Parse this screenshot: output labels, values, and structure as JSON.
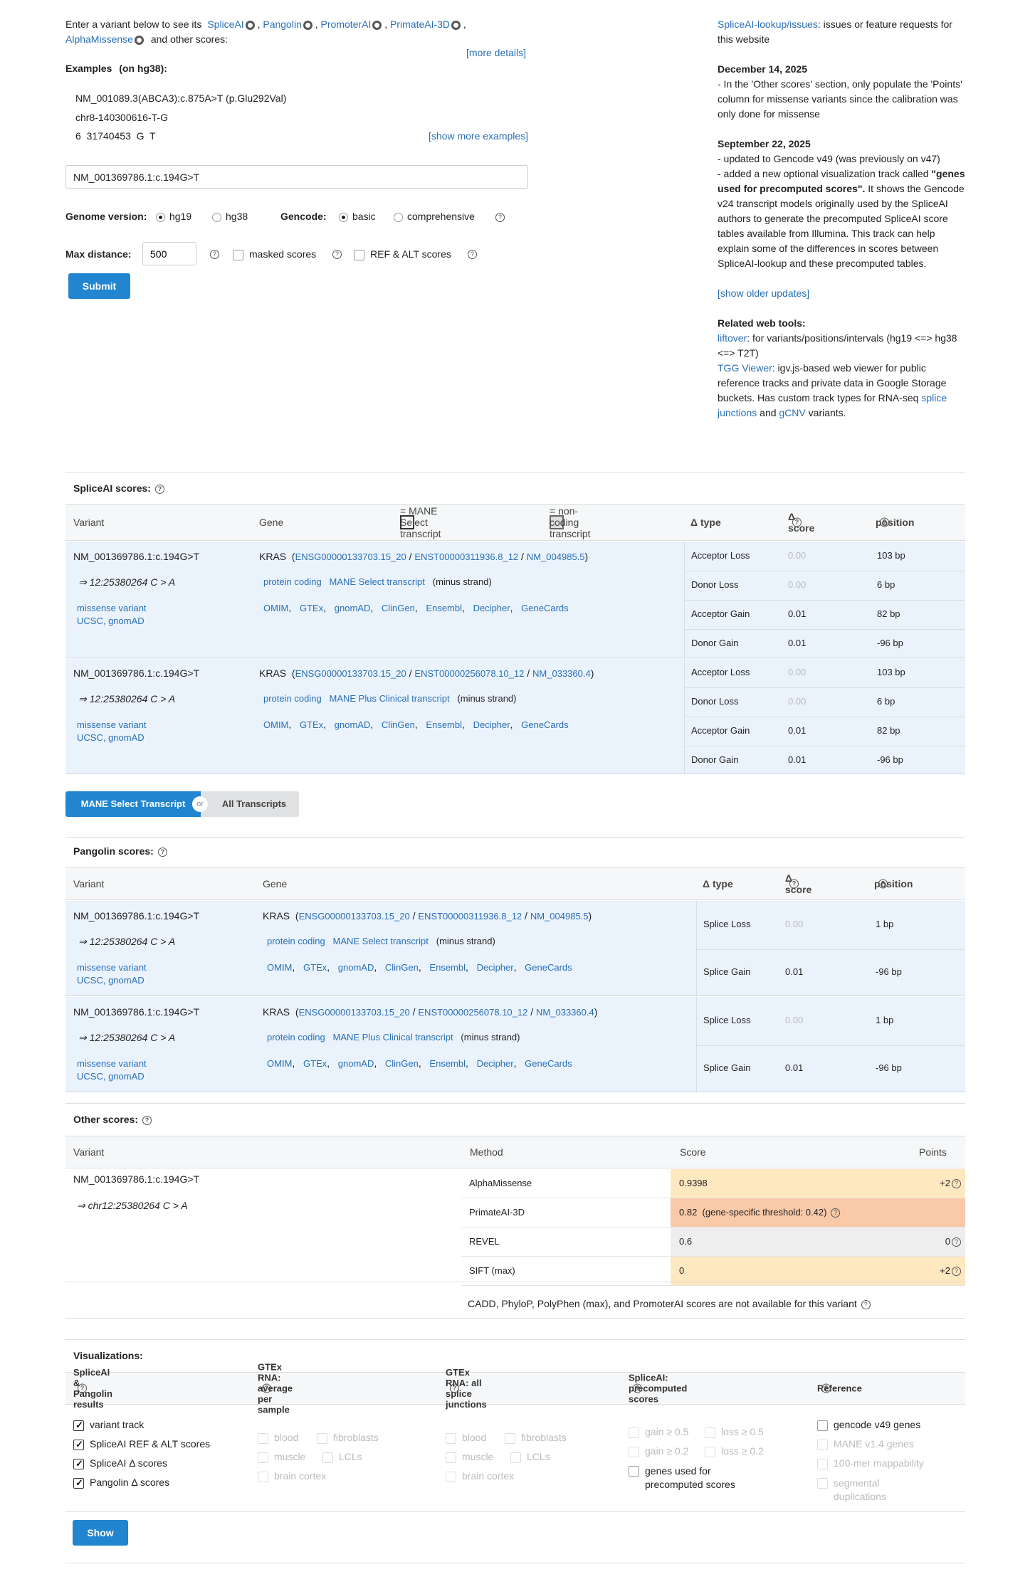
{
  "intro": {
    "text_before": "Enter a variant below to see its",
    "tools": [
      "SpliceAI",
      "Pangolin",
      "PromoterAI",
      "PrimateAI-3D",
      "AlphaMissense"
    ],
    "text_after": "and other scores:",
    "more_details": "[more details]"
  },
  "examples": {
    "title": "Examples",
    "subtitle": "(on hg38):",
    "items": [
      "NM_001089.3(ABCA3):c.875A>T (p.Glu292Val)",
      "chr8-140300616-T-G",
      "6  31740453  G  T"
    ],
    "show_more": "[show more examples]"
  },
  "variant_input": {
    "value": "NM_001369786.1:c.194G>T"
  },
  "options": {
    "genome_label": "Genome version:",
    "genome_options": [
      "hg19",
      "hg38"
    ],
    "gencode_label": "Gencode:",
    "gencode_options": [
      "basic",
      "comprehensive"
    ],
    "max_distance_label": "Max distance:",
    "max_distance_value": "500",
    "masked_label": "masked scores",
    "refalt_label": "REF & ALT scores",
    "submit": "Submit"
  },
  "sidebar": {
    "issues_link": "SpliceAI-lookup/issues",
    "issues_text": ": issues or feature requests for this website",
    "update1_date": "December 14, 2025",
    "update1_text": "- In the 'Other scores' section, only populate the 'Points' column for missense variants since the calibration was only done for missense",
    "update2_date": "September 22, 2025",
    "update2_line1": "- updated to Gencode v49 (was previously on v47)",
    "update2_line2a": "- added a new optional visualization track called",
    "update2_bold": "\"genes used for precomputed scores\".",
    "update2_line2b": "It shows the Gencode v24 transcript models originally used by the SpliceAI authors to generate the precomputed SpliceAI score tables available from Illumina. This track can help explain some of the differences in scores between SpliceAI-lookup and these precomputed tables.",
    "show_older": "[show older updates]",
    "related_title": "Related web tools:",
    "liftover_link": "liftover",
    "liftover_text": ": for variants/positions/intervals (hg19 <=> hg38 <=> T2T)",
    "tgg_link": "TGG Viewer",
    "tgg_text": ": igv.js-based web viewer for public reference tracks and private data in Google Storage buckets. Has custom track types for RNA-seq",
    "splice_link": "splice junctions",
    "and_text": "and",
    "gcnv_link": "gCNV",
    "variants_text": "variants."
  },
  "spliceai": {
    "title": "SpliceAI scores:",
    "headers": {
      "variant": "Variant",
      "gene": "Gene",
      "mane_legend": "= MANE Select transcript",
      "noncoding_legend": "= non-coding transcript",
      "type": "Δ type",
      "score": "Δ score",
      "position": "position"
    },
    "groups": [
      {
        "variant": "NM_001369786.1:c.194G>T",
        "coord": "⇒ 12:25380264 C > A",
        "consequence": "missense variant",
        "link_ucsc": "UCSC",
        "link_gnomad": "gnomAD",
        "gene": "KRAS",
        "ensg": "ENSG00000133703.15_20",
        "enst": "ENST00000311936.8_12",
        "nm": "NM_004985.5",
        "biotype": "protein coding",
        "tag": "MANE Select transcript",
        "strand": "(minus strand)",
        "links": [
          "OMIM",
          "GTEx",
          "gnomAD",
          "ClinGen",
          "Ensembl",
          "Decipher",
          "GeneCards"
        ],
        "rows": [
          {
            "type": "Acceptor Loss",
            "score": "0.00",
            "pos": "103 bp"
          },
          {
            "type": "Donor Loss",
            "score": "0.00",
            "pos": "6 bp"
          },
          {
            "type": "Acceptor Gain",
            "score": "0.01",
            "pos": "82 bp"
          },
          {
            "type": "Donor Gain",
            "score": "0.01",
            "pos": "-96 bp"
          }
        ]
      },
      {
        "variant": "NM_001369786.1:c.194G>T",
        "coord": "⇒ 12:25380264 C > A",
        "consequence": "missense variant",
        "link_ucsc": "UCSC",
        "link_gnomad": "gnomAD",
        "gene": "KRAS",
        "ensg": "ENSG00000133703.15_20",
        "enst": "ENST00000256078.10_12",
        "nm": "NM_033360.4",
        "biotype": "protein coding",
        "tag": "MANE Plus Clinical transcript",
        "strand": "(minus strand)",
        "links": [
          "OMIM",
          "GTEx",
          "gnomAD",
          "ClinGen",
          "Ensembl",
          "Decipher",
          "GeneCards"
        ],
        "rows": [
          {
            "type": "Acceptor Loss",
            "score": "0.00",
            "pos": "103 bp"
          },
          {
            "type": "Donor Loss",
            "score": "0.00",
            "pos": "6 bp"
          },
          {
            "type": "Acceptor Gain",
            "score": "0.01",
            "pos": "82 bp"
          },
          {
            "type": "Donor Gain",
            "score": "0.01",
            "pos": "-96 bp"
          }
        ]
      }
    ]
  },
  "toggle": {
    "left": "MANE Select Transcript",
    "or": "or",
    "right": "All Transcripts"
  },
  "pangolin": {
    "title": "Pangolin scores:",
    "headers": {
      "variant": "Variant",
      "gene": "Gene",
      "type": "Δ type",
      "score": "Δ score",
      "position": "position"
    },
    "groups": [
      {
        "variant": "NM_001369786.1:c.194G>T",
        "coord": "⇒ 12:25380264 C > A",
        "consequence": "missense variant",
        "link_ucsc": "UCSC",
        "link_gnomad": "gnomAD",
        "gene": "KRAS",
        "ensg": "ENSG00000133703.15_20",
        "enst": "ENST00000311936.8_12",
        "nm": "NM_004985.5",
        "biotype": "protein coding",
        "tag": "MANE Select transcript",
        "strand": "(minus strand)",
        "links": [
          "OMIM",
          "GTEx",
          "gnomAD",
          "ClinGen",
          "Ensembl",
          "Decipher",
          "GeneCards"
        ],
        "rows": [
          {
            "type": "Splice Loss",
            "score": "0.00",
            "pos": "1 bp"
          },
          {
            "type": "Splice Gain",
            "score": "0.01",
            "pos": "-96 bp"
          }
        ]
      },
      {
        "variant": "NM_001369786.1:c.194G>T",
        "coord": "⇒ 12:25380264 C > A",
        "consequence": "missense variant",
        "link_ucsc": "UCSC",
        "link_gnomad": "gnomAD",
        "gene": "KRAS",
        "ensg": "ENSG00000133703.15_20",
        "enst": "ENST00000256078.10_12",
        "nm": "NM_033360.4",
        "biotype": "protein coding",
        "tag": "MANE Plus Clinical transcript",
        "strand": "(minus strand)",
        "links": [
          "OMIM",
          "GTEx",
          "gnomAD",
          "ClinGen",
          "Ensembl",
          "Decipher",
          "GeneCards"
        ],
        "rows": [
          {
            "type": "Splice Loss",
            "score": "0.00",
            "pos": "1 bp"
          },
          {
            "type": "Splice Gain",
            "score": "0.01",
            "pos": "-96 bp"
          }
        ]
      }
    ]
  },
  "other": {
    "title": "Other scores:",
    "headers": {
      "variant": "Variant",
      "method": "Method",
      "score": "Score",
      "points": "Points"
    },
    "variant": "NM_001369786.1:c.194G>T",
    "coord": "⇒ chr12:25380264 C > A",
    "rows": [
      {
        "method": "AlphaMissense",
        "score": "0.9398",
        "points": "+2",
        "color": "#fde8c0"
      },
      {
        "method": "PrimateAI-3D",
        "score": "0.82  (gene-specific threshold: 0.42)",
        "points": "",
        "color": "#f9c9a8"
      },
      {
        "method": "REVEL",
        "score": "0.6",
        "points": "0",
        "color": "#eeeeee"
      },
      {
        "method": "SIFT (max)",
        "score": "0",
        "points": "+2",
        "color": "#fde8c0"
      }
    ],
    "note": "CADD,  PhyloP,  PolyPhen (max),  and PromoterAI scores are not available for this variant"
  },
  "viz": {
    "title": "Visualizations:",
    "col1_title": "SpliceAI & Pangolin results",
    "col1_items": [
      "variant track",
      "SpliceAI REF & ALT scores",
      "SpliceAI Δ  scores",
      "Pangolin Δ  scores"
    ],
    "col2_title": "GTEx RNA: average per sample",
    "col2_items": [
      "blood",
      "fibroblasts",
      "muscle",
      "LCLs",
      "brain cortex"
    ],
    "col3_title": "GTEx RNA: all splice junctions",
    "col3_items": [
      "blood",
      "fibroblasts",
      "muscle",
      "LCLs",
      "brain cortex"
    ],
    "col4_title": "SpliceAI: precomputed scores",
    "col4_items": [
      "gain ≥ 0.5",
      "loss ≥ 0.5",
      "gain ≥ 0.2",
      "loss ≥ 0.2",
      "genes used for precomputed scores"
    ],
    "col5_title": "Reference",
    "col5_items": [
      "gencode v49 genes",
      "MANE v1.4 genes",
      "100-mer mappability",
      "segmental duplications"
    ],
    "show": "Show"
  }
}
